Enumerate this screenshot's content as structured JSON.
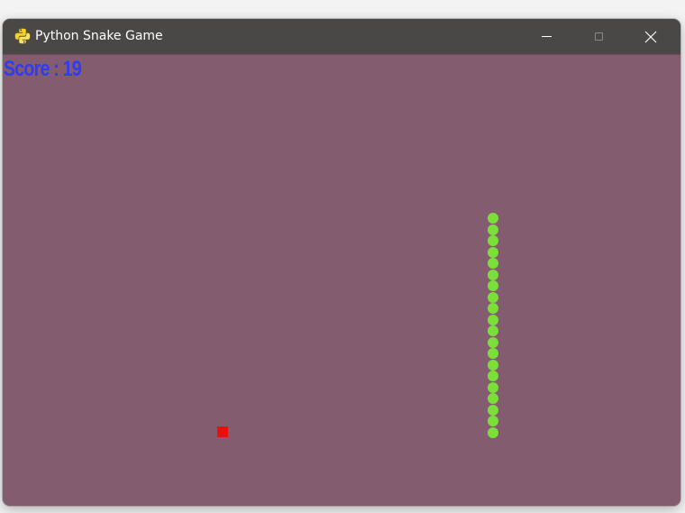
{
  "window": {
    "title": "Python Snake Game",
    "icon": "python-snake-icon",
    "controls": [
      "minimize-icon",
      "maximize-icon",
      "close-icon"
    ]
  },
  "game": {
    "score_text": "Score : 19",
    "score": 19,
    "snake_length": 20,
    "colors": {
      "background": "#845c70",
      "snake": "#7ae039",
      "food": "#e80f0f",
      "score_text": "#2f3bf5"
    }
  }
}
